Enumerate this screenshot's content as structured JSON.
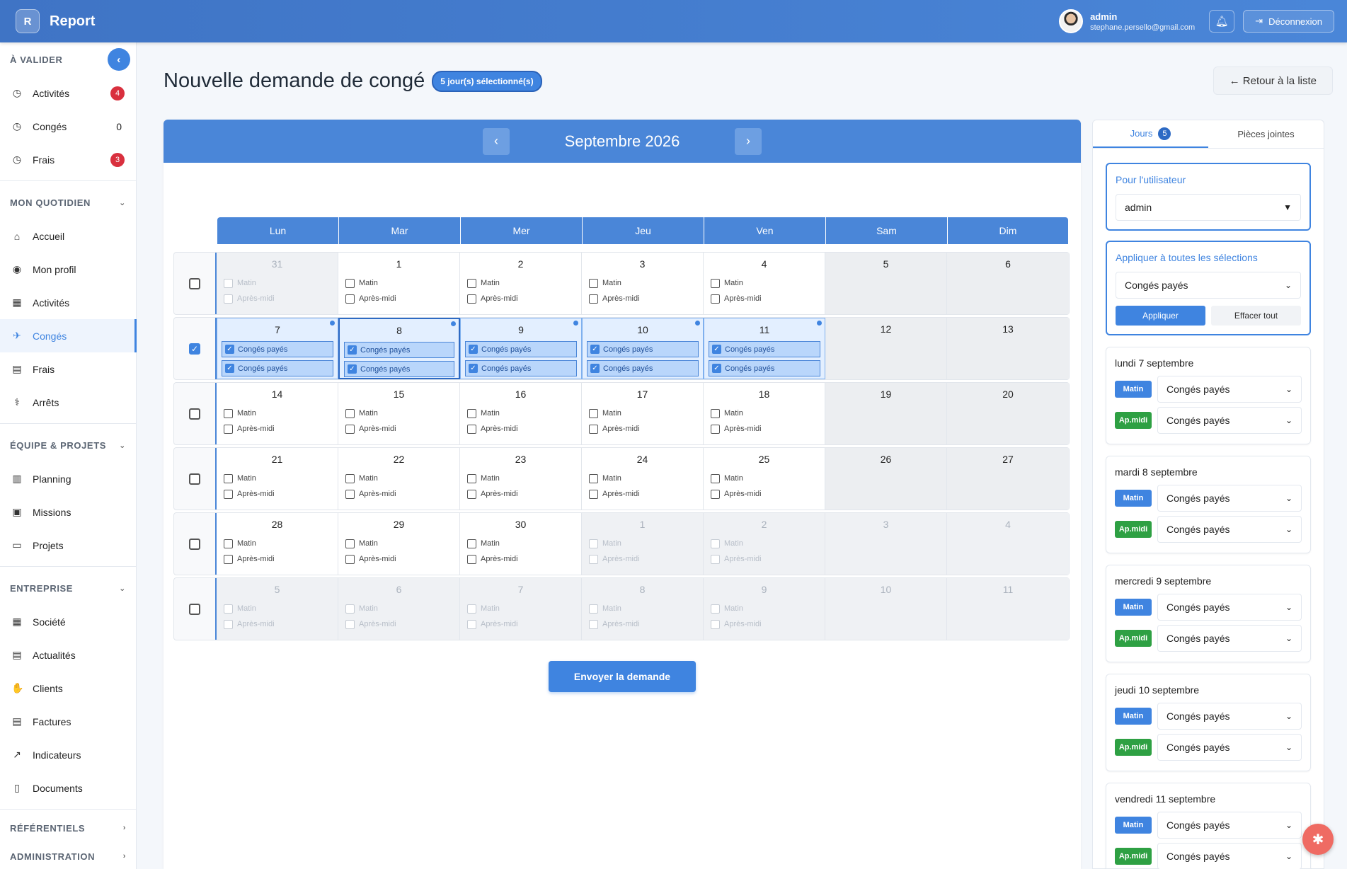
{
  "app": {
    "logo_letter": "R",
    "title": "Report"
  },
  "user": {
    "name": "admin",
    "email": "stephane.persello@gmail.com"
  },
  "header": {
    "logout_label": "Déconnexion"
  },
  "sidebar": {
    "sections": [
      {
        "title": "À VALIDER",
        "items": [
          {
            "label": "Activités",
            "icon": "check-circle-icon",
            "badge": "4",
            "badge_type": "red"
          },
          {
            "label": "Congés",
            "icon": "check-circle-icon",
            "badge": "0",
            "badge_type": "plain"
          },
          {
            "label": "Frais",
            "icon": "check-circle-icon",
            "badge": "3",
            "badge_type": "red"
          }
        ]
      },
      {
        "title": "MON QUOTIDIEN",
        "items": [
          {
            "label": "Accueil",
            "icon": "home-icon"
          },
          {
            "label": "Mon profil",
            "icon": "user-circle-icon"
          },
          {
            "label": "Activités",
            "icon": "calendar-icon"
          },
          {
            "label": "Congés",
            "icon": "plane-icon",
            "active": true
          },
          {
            "label": "Frais",
            "icon": "receipt-icon"
          },
          {
            "label": "Arrêts",
            "icon": "health-icon"
          }
        ]
      },
      {
        "title": "ÉQUIPE & PROJETS",
        "items": [
          {
            "label": "Planning",
            "icon": "clipboard-icon"
          },
          {
            "label": "Missions",
            "icon": "briefcase-icon"
          },
          {
            "label": "Projets",
            "icon": "folder-icon"
          }
        ]
      },
      {
        "title": "ENTREPRISE",
        "items": [
          {
            "label": "Société",
            "icon": "building-icon"
          },
          {
            "label": "Actualités",
            "icon": "newspaper-icon"
          },
          {
            "label": "Clients",
            "icon": "handshake-icon"
          },
          {
            "label": "Factures",
            "icon": "invoice-icon"
          },
          {
            "label": "Indicateurs",
            "icon": "trend-icon"
          },
          {
            "label": "Documents",
            "icon": "book-icon"
          }
        ]
      }
    ],
    "footer_sections": [
      "RÉFÉRENTIELS",
      "ADMINISTRATION"
    ]
  },
  "page": {
    "title": "Nouvelle demande de congé",
    "selection_badge": "5 jour(s) sélectionné(s)",
    "back_label": "← Retour à la liste"
  },
  "calendar": {
    "month_label": "Septembre 2026",
    "prev_label": "‹",
    "next_label": "›",
    "weekdays": [
      "Lun",
      "Mar",
      "Mer",
      "Jeu",
      "Ven",
      "Sam",
      "Dim"
    ],
    "slot_morning": "Matin",
    "slot_afternoon": "Après-midi",
    "leave_label": "Congés payés",
    "weeks": [
      {
        "checked": false,
        "days": [
          [
            "31",
            "muted"
          ],
          [
            "1",
            ""
          ],
          [
            "2",
            ""
          ],
          [
            "3",
            ""
          ],
          [
            "4",
            ""
          ],
          [
            "5",
            "weekend"
          ],
          [
            "6",
            "weekend"
          ]
        ]
      },
      {
        "checked": true,
        "days": [
          [
            "7",
            "selected"
          ],
          [
            "8",
            "selected boxed"
          ],
          [
            "9",
            "selected"
          ],
          [
            "10",
            "selected"
          ],
          [
            "11",
            "selected"
          ],
          [
            "12",
            "weekend"
          ],
          [
            "13",
            "weekend"
          ]
        ]
      },
      {
        "checked": false,
        "days": [
          [
            "14",
            ""
          ],
          [
            "15",
            ""
          ],
          [
            "16",
            ""
          ],
          [
            "17",
            ""
          ],
          [
            "18",
            ""
          ],
          [
            "19",
            "weekend"
          ],
          [
            "20",
            "weekend"
          ]
        ]
      },
      {
        "checked": false,
        "days": [
          [
            "21",
            ""
          ],
          [
            "22",
            ""
          ],
          [
            "23",
            ""
          ],
          [
            "24",
            ""
          ],
          [
            "25",
            ""
          ],
          [
            "26",
            "weekend"
          ],
          [
            "27",
            "weekend"
          ]
        ]
      },
      {
        "checked": false,
        "days": [
          [
            "28",
            ""
          ],
          [
            "29",
            ""
          ],
          [
            "30",
            ""
          ],
          [
            "1",
            "muted"
          ],
          [
            "2",
            "muted"
          ],
          [
            "3",
            "weekend muted"
          ],
          [
            "4",
            "weekend muted"
          ]
        ]
      },
      {
        "checked": false,
        "days": [
          [
            "5",
            "muted"
          ],
          [
            "6",
            "muted"
          ],
          [
            "7",
            "muted"
          ],
          [
            "8",
            "muted"
          ],
          [
            "9",
            "muted"
          ],
          [
            "10",
            "weekend muted"
          ],
          [
            "11",
            "weekend muted"
          ]
        ]
      }
    ],
    "send_label": "Envoyer la demande"
  },
  "panel": {
    "tab_days": "Jours",
    "tab_days_count": "5",
    "tab_attachments": "Pièces jointes",
    "user_card_title": "Pour l'utilisateur",
    "user_value": "admin",
    "apply_card_title": "Appliquer à toutes les sélections",
    "apply_value": "Congés payés",
    "apply_btn": "Appliquer",
    "clear_btn": "Effacer tout",
    "morning_tag": "Matin",
    "afternoon_tag": "Ap.midi",
    "days": [
      {
        "title": "lundi 7 septembre",
        "morning": "Congés payés",
        "afternoon": "Congés payés"
      },
      {
        "title": "mardi 8 septembre",
        "morning": "Congés payés",
        "afternoon": "Congés payés"
      },
      {
        "title": "mercredi 9 septembre",
        "morning": "Congés payés",
        "afternoon": "Congés payés"
      },
      {
        "title": "jeudi 10 septembre",
        "morning": "Congés payés",
        "afternoon": "Congés payés"
      },
      {
        "title": "vendredi 11 septembre",
        "morning": "Congés payés",
        "afternoon": "Congés payés"
      }
    ]
  },
  "colors": {
    "primary": "#3f84e0",
    "danger": "#d9303e",
    "success": "#2ea043",
    "fab": "#ef6b63"
  }
}
